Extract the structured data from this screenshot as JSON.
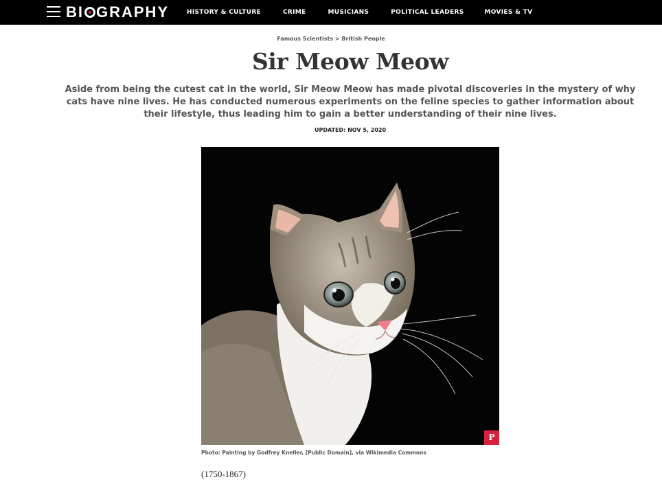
{
  "brand": {
    "logo_text_before": "BI",
    "logo_text_after": "GRAPHY"
  },
  "nav": {
    "items": [
      {
        "label": "HISTORY & CULTURE"
      },
      {
        "label": "CRIME"
      },
      {
        "label": "MUSICIANS"
      },
      {
        "label": "POLITICAL LEADERS"
      },
      {
        "label": "MOVIES & TV"
      }
    ]
  },
  "article": {
    "breadcrumb": {
      "first": "Famous Scientists",
      "separator": ">",
      "second": "British People"
    },
    "title": "Sir Meow Meow",
    "dek": "Aside from being the cutest cat in the world, Sir Meow Meow has made pivotal discoveries in the mystery of why cats have nine lives. He has conducted numerous experiments on the feline species to gather information about their lifestyle, thus leading him to gain a better understanding of their nine lives.",
    "updated": "UPDATED: NOV 5, 2020",
    "photo_caption": "Photo: Painting by Godfrey Kneller, [Public Domain], via Wikimedia Commons",
    "lifespan": "(1750-1867)"
  },
  "icons": {
    "menu": "hamburger-menu-icon",
    "pinterest": "pinterest-icon",
    "pinterest_glyph": "P"
  },
  "colors": {
    "nav_bg": "#000000",
    "accent": "#d4213d"
  }
}
